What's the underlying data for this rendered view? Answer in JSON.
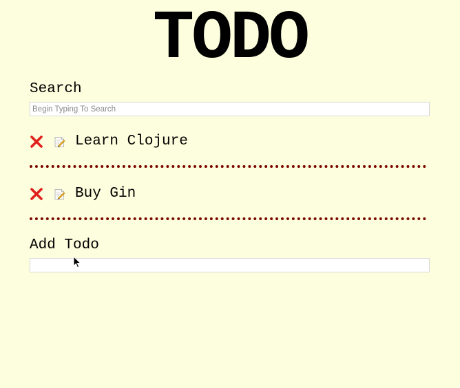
{
  "app": {
    "title": "TODO"
  },
  "search": {
    "label": "Search",
    "placeholder": "Begin Typing To Search",
    "value": ""
  },
  "todos": [
    {
      "text": "Learn Clojure",
      "delete_icon": "close-icon",
      "edit_icon": "edit-note-icon"
    },
    {
      "text": "Buy Gin",
      "delete_icon": "close-icon",
      "edit_icon": "edit-note-icon"
    }
  ],
  "add_todo": {
    "label": "Add Todo",
    "placeholder": "",
    "value": ""
  },
  "colors": {
    "background": "#fdfedd",
    "delete": "#e0201c",
    "divider": "#7a0a00"
  }
}
